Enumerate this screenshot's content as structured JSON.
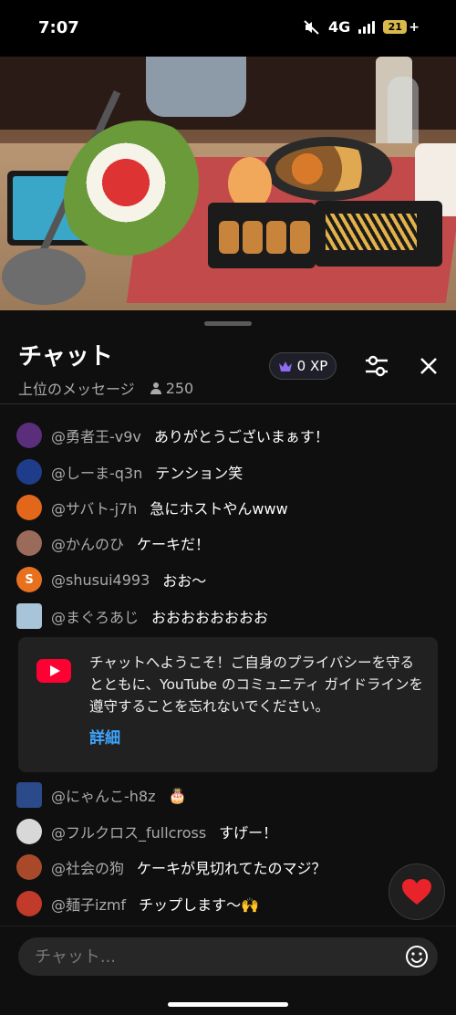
{
  "status_bar": {
    "time": "7:07",
    "network": "4G",
    "battery": "21"
  },
  "chat": {
    "title": "チャット",
    "mode_label": "上位のメッセージ",
    "viewer_count": "250",
    "xp_label": "0 XP",
    "messages_top": [
      {
        "author": "@勇者王-v9v",
        "text": "ありがとうございまぁす！",
        "avatar_color": "#5a2e7a"
      },
      {
        "author": "@しーま-q3n",
        "text": "テンション笑",
        "avatar_color": "#1e3c8a"
      },
      {
        "author": "@サバト-j7h",
        "text": "急にホストやんwww",
        "avatar_color": "#e2671a"
      },
      {
        "author": "@かんのひ",
        "text": "ケーキだ！",
        "avatar_color": "#9a6b5a"
      },
      {
        "author": "@shusui4993",
        "text": "おお〜",
        "avatar_color": "#e8711f",
        "avatar_letter": "S"
      },
      {
        "author": "@まぐろあじ",
        "text": "おおおおおおおお",
        "avatar_color": "#a8c4d8"
      }
    ],
    "welcome": {
      "text": "チャットへようこそ！ご自身のプライバシーを守るとともに、YouTube のコミュニティ ガイドラインを遵守することを忘れないでください。",
      "more_label": "詳細"
    },
    "messages_bottom": [
      {
        "author": "@にゃんこ-h8z",
        "text": "🎂",
        "avatar_color": "#2a4a8a"
      },
      {
        "author": "@フルクロス_fullcross",
        "text": "すげー！",
        "avatar_color": "#d8d8d8"
      },
      {
        "author": "@社会の狗",
        "text": "ケーキが見切れてたのマジ？",
        "avatar_color": "#a84a2a"
      },
      {
        "author": "@麺子izmf",
        "text": "チップします〜🙌",
        "avatar_color": "#c23a2a"
      }
    ],
    "input_placeholder": "チャット..."
  }
}
